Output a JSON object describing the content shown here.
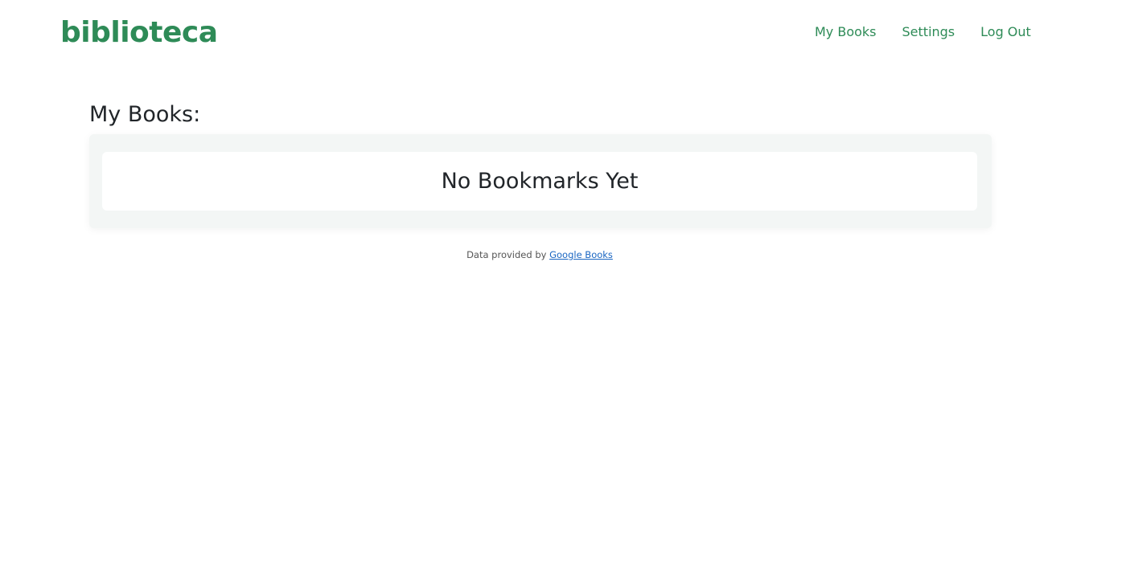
{
  "header": {
    "brand": "biblioteca",
    "nav": {
      "my_books": "My Books",
      "settings": "Settings",
      "log_out": "Log Out"
    }
  },
  "main": {
    "title": "My Books:",
    "empty_message": "No Bookmarks Yet"
  },
  "footer": {
    "prefix": "Data provided by",
    "link_text": "Google Books"
  },
  "colors": {
    "brand": "#2e8b57",
    "text": "#212529",
    "panel": "#f3f6f5",
    "link": "#1a66c2"
  }
}
